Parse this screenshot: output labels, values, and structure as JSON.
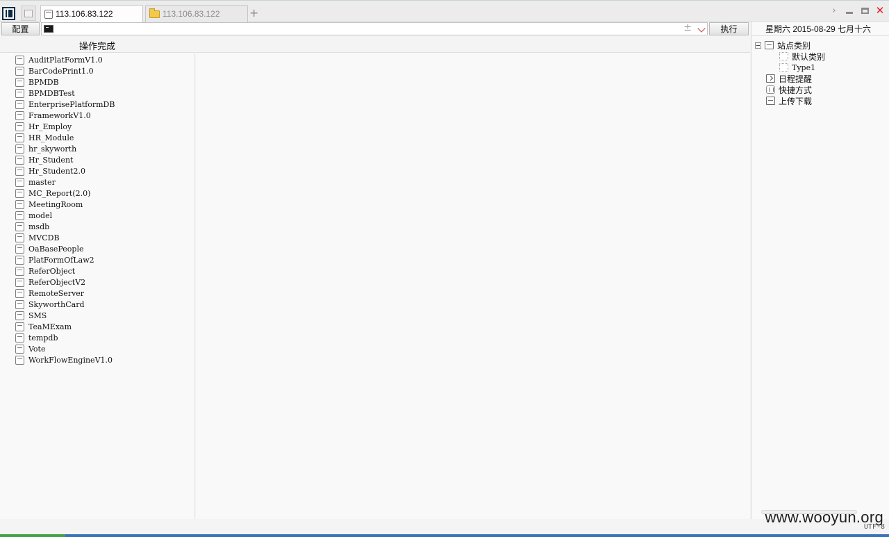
{
  "tabs": [
    {
      "label": "113.106.83.122",
      "active": true
    },
    {
      "label": "113.106.83.122",
      "active": false
    }
  ],
  "toolbar": {
    "config_label": "配置",
    "command_value": "",
    "execute_label": "执行",
    "plus_glyph": "±"
  },
  "status_message": "操作完成",
  "databases": [
    "AuditPlatFormV1.0",
    "BarCodePrint1.0",
    "BPMDB",
    "BPMDBTest",
    "EnterprisePlatformDB",
    "FrameworkV1.0",
    "Hr_Employ",
    "HR_Module",
    "hr_skyworth",
    "Hr_Student",
    "Hr_Student2.0",
    "master",
    "MC_Report(2.0)",
    "MeetingRoom",
    "model",
    "msdb",
    "MVCDB",
    "OaBasePeople",
    "PlatFormOfLaw2",
    "ReferObject",
    "ReferObjectV2",
    "RemoteServer",
    "SkyworthCard",
    "SMS",
    "TeaMExam",
    "tempdb",
    "Vote",
    "WorkFlowEngineV1.0"
  ],
  "sidebar": {
    "date": "星期六 2015-08-29 七月十六",
    "site_category": "站点类别",
    "default_category": "默认类别",
    "type1": "Type1",
    "reminder": "日程提醒",
    "shortcut": "快捷方式",
    "upload_download": "上传下载"
  },
  "footer": {
    "encoding": "UTF-8",
    "watermark": "www.wooyun.org"
  },
  "colors": {
    "close_button": "#e21d1d",
    "taskbar_blue": "#3b73b9",
    "taskbar_green": "#45a047"
  }
}
